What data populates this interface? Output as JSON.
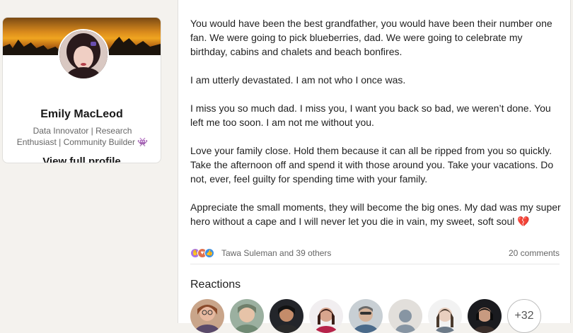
{
  "profile": {
    "name": "Emily MacLeod",
    "headline_line1": "Data Innovator | Research",
    "headline_line2": "Enthusiast | Community Builder",
    "headline_emoji": "👾",
    "view_profile": "View full profile"
  },
  "post": {
    "paragraphs": [
      "You would have been the best grandfather, you would have been their number one fan. We were going to pick blueberries, dad. We were going to celebrate my birthday, cabins and chalets and beach bonfires.",
      "I am utterly devastated. I am not who I once was.",
      "I miss you so much dad. I miss you, I want you back so bad, we weren’t done. You left me too soon. I am not me without you.",
      "Love your family close. Hold them because it can all be ripped from you so quickly. Take the afternoon off and spend it with those around you. Take your vacations. Do not, ever, feel guilty for spending time with your family.",
      "Appreciate the small moments, they will become the big ones. My dad was my super hero without a cape and I will never let you die in vain, my sweet, soft soul 💔"
    ],
    "reaction_icons": [
      "support-icon",
      "love-icon",
      "like-icon"
    ],
    "reactions_text": "Tawa Suleman and 39 others",
    "comments_text": "20 comments"
  },
  "reactions": {
    "title": "Reactions",
    "more_count": "+32"
  },
  "colors": {
    "page_bg": "#f4f2ee",
    "card_bg": "#ffffff",
    "like_blue": "#378fe9",
    "love_red": "#df704d",
    "support_purple": "#a872e8"
  }
}
